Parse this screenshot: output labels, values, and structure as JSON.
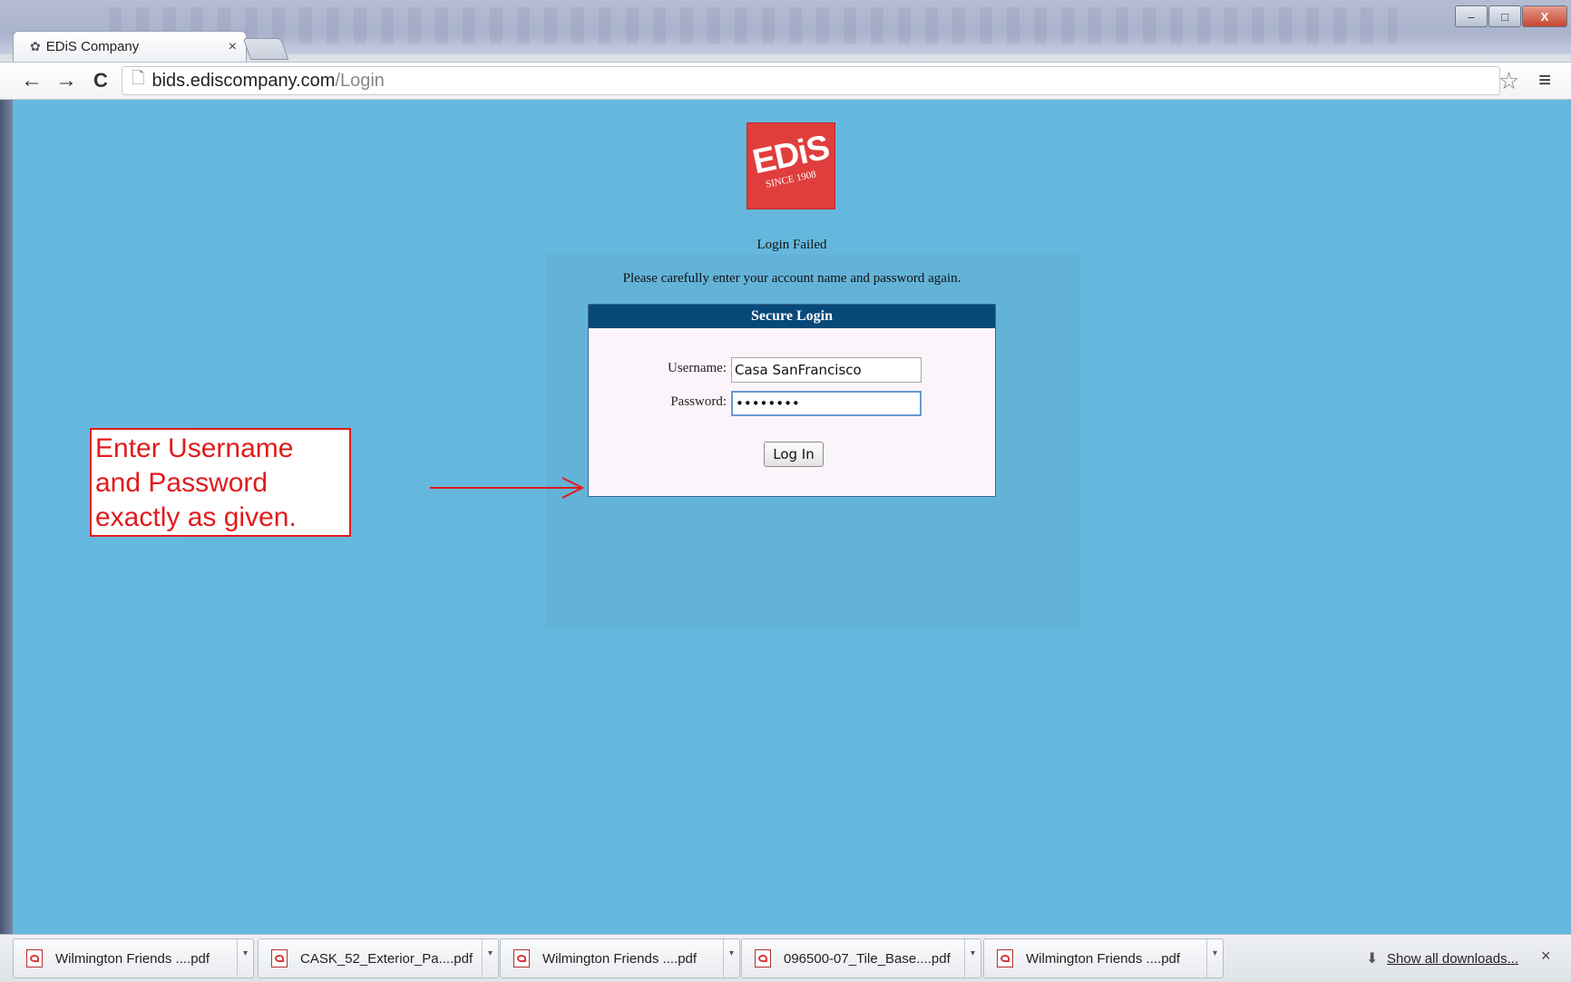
{
  "browser": {
    "tab_title": "EDiS Company",
    "tab_close": "×",
    "url_host": "bids.ediscompany.com",
    "url_path": "/Login",
    "back": "←",
    "forward": "→",
    "reload": "C",
    "star": "☆",
    "menu": "≡",
    "win_min": "–",
    "win_max": "□",
    "win_close": "X"
  },
  "logo": {
    "brand": "EDiS",
    "since": "SINCE 1908"
  },
  "login": {
    "status": "Login Failed",
    "instructions": "Please carefully enter your account name and password again.",
    "header": "Secure Login",
    "username_label": "Username:",
    "username_value": "Casa SanFrancisco",
    "password_label": "Password:",
    "password_value": "••••••••",
    "button_label": "Log In"
  },
  "annotation": {
    "line1": "Enter Username",
    "line2": "and Password",
    "line3": "exactly as given.",
    "color": "#e21b1b"
  },
  "downloads": {
    "items": [
      {
        "name": "Wilmington Friends ....pdf"
      },
      {
        "name": "CASK_52_Exterior_Pa....pdf"
      },
      {
        "name": "Wilmington Friends ....pdf"
      },
      {
        "name": "096500-07_Tile_Base....pdf"
      },
      {
        "name": "Wilmington Friends ....pdf"
      }
    ],
    "show_all": "Show all downloads...",
    "close": "×"
  },
  "colors": {
    "page_bg": "#67b8de",
    "login_header_bg": "#074a7a",
    "logo_red": "#e03e3c"
  }
}
